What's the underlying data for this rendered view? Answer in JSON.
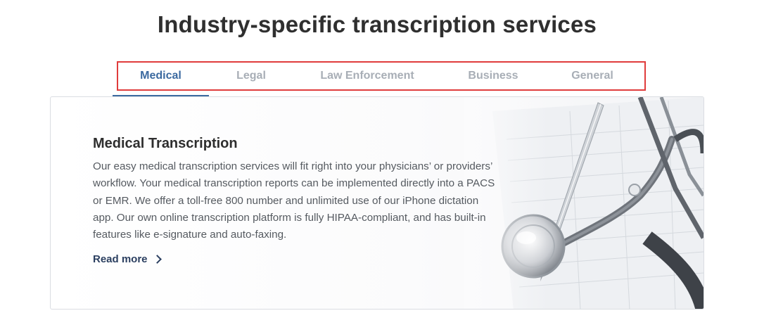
{
  "section": {
    "title": "Industry-specific transcription services"
  },
  "tabs": [
    {
      "label": "Medical",
      "active": true
    },
    {
      "label": "Legal",
      "active": false
    },
    {
      "label": "Law Enforcement",
      "active": false
    },
    {
      "label": "Business",
      "active": false
    },
    {
      "label": "General",
      "active": false
    }
  ],
  "panel": {
    "title": "Medical Transcription",
    "body": "Our easy medical transcription services will fit right into your physicians’ or providers’ workflow. Your medical transcription reports can be implemented directly into a PACS or EMR. We offer a toll-free 800 number and unlimited use of our iPhone dictation app. Our own online transcription platform is fully HIPAA-compliant, and has built-in features like e-signature and auto-faxing.",
    "read_more_label": "Read more",
    "image_icon": "stethoscope-pen-document-image"
  },
  "colors": {
    "accent": "#3c6aa0",
    "highlight_box": "#e03c3c",
    "inactive_tab": "#a8aeb6",
    "link": "#2b3f60"
  }
}
